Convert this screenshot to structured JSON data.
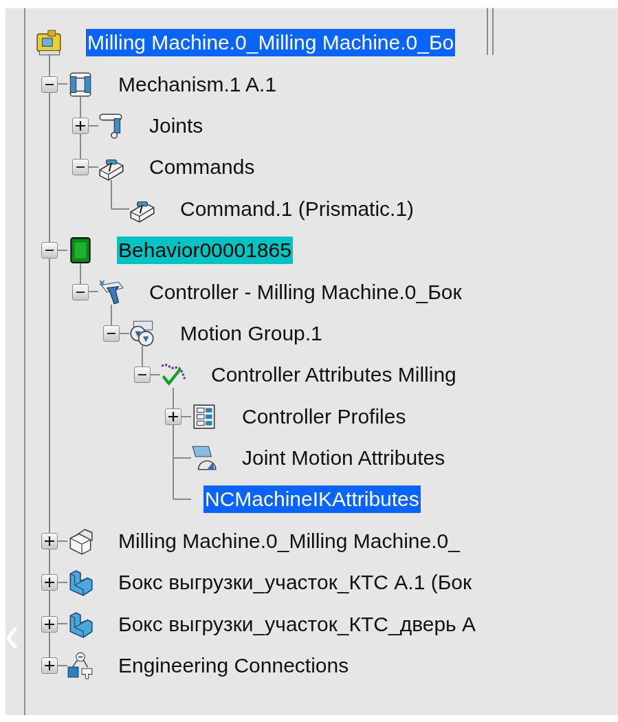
{
  "tree": {
    "label": "Milling Machine.0_Milling Machine.0_Бо",
    "kind": "machine",
    "selected": true,
    "highlighted": false,
    "children": [
      {
        "label": "Mechanism.1 A.1",
        "kind": "linkage",
        "expanded": true,
        "selected": false,
        "highlighted": false,
        "children": [
          {
            "label": "Joints",
            "kind": "link",
            "expanded": false,
            "selected": false,
            "highlighted": false
          },
          {
            "label": "Commands",
            "kind": "slider-box",
            "expanded": true,
            "selected": false,
            "highlighted": false,
            "children": [
              {
                "label": "Command.1 (Prismatic.1)",
                "kind": "slider-box",
                "selected": false,
                "highlighted": false
              }
            ]
          }
        ]
      },
      {
        "label": "Behavior00001865",
        "kind": "chip",
        "expanded": true,
        "selected": false,
        "highlighted": true,
        "children": [
          {
            "label": "Controller - Milling Machine.0_Бок",
            "kind": "robot-arm",
            "expanded": true,
            "selected": false,
            "highlighted": false,
            "children": [
              {
                "label": "Motion Group.1",
                "kind": "dial-pair",
                "expanded": true,
                "selected": false,
                "highlighted": false,
                "children": [
                  {
                    "label": "Controller Attributes Milling",
                    "kind": "checkmark",
                    "expanded": true,
                    "selected": false,
                    "highlighted": false,
                    "children": [
                      {
                        "label": "Controller Profiles",
                        "kind": "list",
                        "expanded": false,
                        "selected": false,
                        "highlighted": false
                      },
                      {
                        "label": "Joint Motion Attributes",
                        "kind": "gauge",
                        "selected": false,
                        "highlighted": false
                      },
                      {
                        "label": "NCMachineIKAttributes",
                        "selected": true,
                        "highlighted": false
                      }
                    ]
                  }
                ]
              }
            ]
          }
        ]
      },
      {
        "label": "Milling Machine.0_Milling Machine.0_",
        "kind": "parts",
        "expanded": false,
        "selected": false,
        "highlighted": false
      },
      {
        "label": "Бокс выгрузки_участок_КТС А.1 (Бок",
        "kind": "part",
        "expanded": false,
        "selected": false,
        "highlighted": false
      },
      {
        "label": "Бокс выгрузки_участок_КТС_дверь А",
        "kind": "part",
        "expanded": false,
        "selected": false,
        "highlighted": false
      },
      {
        "label": "Engineering Connections",
        "kind": "connection",
        "expanded": false,
        "selected": false,
        "highlighted": false
      }
    ]
  }
}
